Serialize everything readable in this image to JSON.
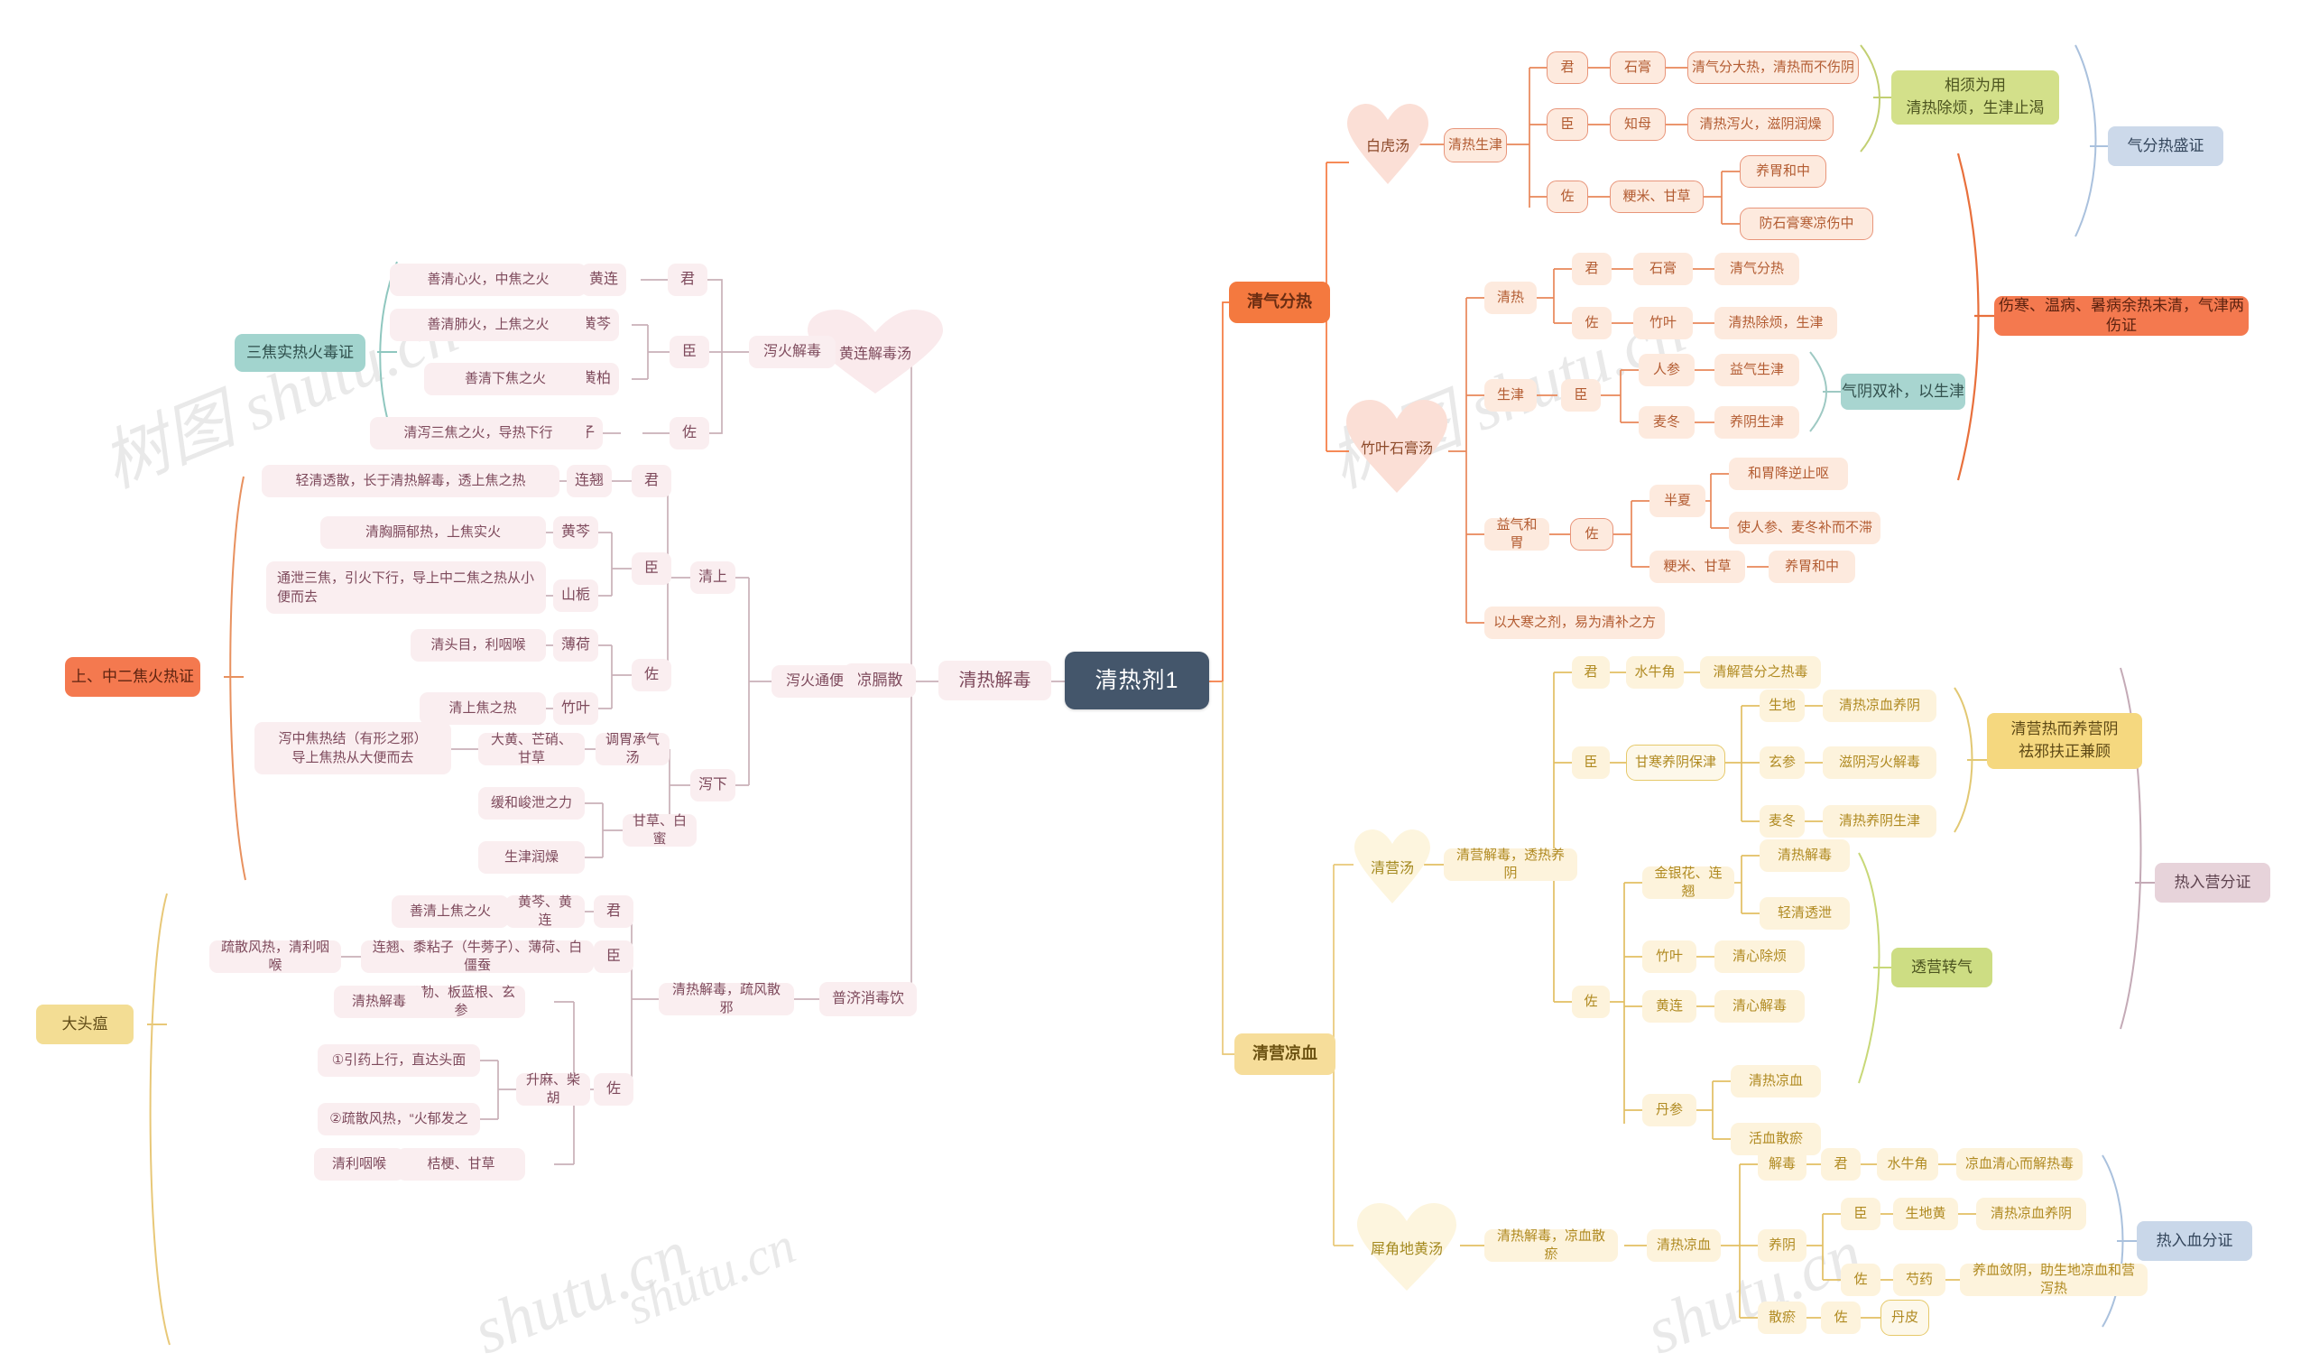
{
  "root": {
    "label": "清热剂1"
  },
  "watermark": {
    "text": "树图 shutu.cn"
  },
  "branches": {
    "left": {
      "label": "清热解毒",
      "formulas": [
        {
          "name": "黄连解毒汤",
          "function": "泻火解毒",
          "syndrome": "三焦实热火毒证",
          "roles": [
            {
              "role": "君",
              "herb": "黄连",
              "effect": "善清心火，中焦之火"
            },
            {
              "role": "臣",
              "herbs": [
                "黄芩",
                "黄柏"
              ],
              "effects": [
                "善清肺火，上焦之火",
                "善清下焦之火"
              ]
            },
            {
              "role": "佐",
              "herb": "栀子",
              "effect": "清泻三焦之火，导热下行"
            }
          ]
        },
        {
          "name": "凉膈散",
          "function": "泻火通便",
          "syndrome": "上、中二焦火热证",
          "groups": [
            {
              "label": "清上",
              "rows": [
                {
                  "role": "君",
                  "herb": "连翘",
                  "effect": "轻清透散，长于清热解毒，透上焦之热"
                },
                {
                  "role": "臣",
                  "herbs": [
                    "黄芩",
                    "山栀"
                  ],
                  "effects": [
                    "清胸膈郁热，上焦实火",
                    "通泄三焦，引火下行，导上中二焦之热从小便而去"
                  ]
                },
                {
                  "role": "佐",
                  "herbs": [
                    "薄荷",
                    "竹叶"
                  ],
                  "effects": [
                    "清头目，利咽喉",
                    "清上焦之热"
                  ]
                }
              ]
            },
            {
              "label": "泻下",
              "rows": [
                {
                  "herb": "调胃承气汤",
                  "sub": "大黄、芒硝、甘草",
                  "effect": "泻中焦热结（有形之邪）\n导上焦热从大便而去"
                },
                {
                  "herb": "甘草、白蜜",
                  "effects": [
                    "缓和峻泄之力",
                    "生津润燥"
                  ]
                }
              ]
            }
          ]
        },
        {
          "name": "普济消毒饮",
          "function": "清热解毒，疏风散邪",
          "syndrome": "大头瘟",
          "roles": [
            {
              "role": "君",
              "herb": "黄芩、黄连",
              "effect": "善清上焦之火"
            },
            {
              "role": "臣",
              "herb": "连翘、黍粘子（牛蒡子）、薄荷、白僵蚕",
              "effect": "疏散风热，清利咽喉"
            },
            {
              "role": "佐",
              "herbs": [
                "马勃、板蓝根、玄参",
                "升麻、柴胡",
                "桔梗、甘草"
              ],
              "effects": [
                "清热解毒",
                "①引药上行，直达头面",
                "②疏散风热，“火郁发之",
                "清利咽喉"
              ]
            }
          ]
        }
      ]
    },
    "right_top": {
      "label": "清气分热",
      "formulas": [
        {
          "name": "白虎汤",
          "function": "清热生津",
          "note": "相须为用\n清热除烦，生津止渴",
          "syndrome": "气分热盛证",
          "rows": [
            {
              "role": "君",
              "herb": "石膏",
              "effect": "清气分大热，清热而不伤阴"
            },
            {
              "role": "臣",
              "herb": "知母",
              "effect": "清热泻火，滋阴润燥"
            },
            {
              "role": "佐",
              "herb": "粳米、甘草",
              "effects": [
                "养胃和中",
                "防石膏寒凉伤中"
              ]
            }
          ]
        },
        {
          "name": "竹叶石膏汤",
          "note": "气阴双补，以生津",
          "syndrome": "伤寒、温病、暑病余热未清，气津两伤证",
          "groups": [
            {
              "label": "清热",
              "rows": [
                {
                  "role": "君",
                  "herb": "石膏",
                  "effect": "清气分热"
                },
                {
                  "role": "佐",
                  "herb": "竹叶",
                  "effect": "清热除烦，生津"
                }
              ]
            },
            {
              "label": "生津",
              "rows": [
                {
                  "role": "臣",
                  "herbs": [
                    "人参",
                    "麦冬"
                  ],
                  "effects": [
                    "益气生津",
                    "养阴生津"
                  ]
                }
              ]
            },
            {
              "label": "益气和胃",
              "rows": [
                {
                  "role": "佐",
                  "herb": "半夏",
                  "effects": [
                    "和胃降逆止呕",
                    "使人参、麦冬补而不滞"
                  ]
                },
                {
                  "herb": "粳米、甘草",
                  "effect": "养胃和中"
                }
              ]
            },
            {
              "label": "以大寒之剂，易为清补之方"
            }
          ]
        }
      ]
    },
    "right_bottom": {
      "label": "清营凉血",
      "formulas": [
        {
          "name": "清营汤",
          "function": "清营解毒，透热养阴",
          "note1": "清营热而养营阴\n祛邪扶正兼顾",
          "note2": "透营转气",
          "syndrome": "热入营分证",
          "rows": [
            {
              "role": "君",
              "herb": "水牛角",
              "effect": "清解营分之热毒"
            },
            {
              "role": "臣",
              "group": "甘寒养阴保津",
              "herbs": [
                "生地",
                "玄参",
                "麦冬"
              ],
              "effects": [
                "清热凉血养阴",
                "滋阴泻火解毒",
                "清热养阴生津"
              ]
            },
            {
              "role": "佐",
              "herbs": [
                "金银花、连翘",
                "竹叶",
                "黄连",
                "丹参"
              ],
              "effects": [
                "清热解毒",
                "轻清透泄",
                "清心除烦",
                "清心解毒",
                "清热凉血",
                "活血散瘀"
              ]
            }
          ]
        },
        {
          "name": "犀角地黄汤",
          "function": "清热解毒，凉血散瘀",
          "mid": "清热凉血",
          "syndrome": "热入血分证",
          "groups": [
            {
              "label": "解毒",
              "rows": [
                {
                  "role": "君",
                  "herb": "水牛角",
                  "effect": "凉血清心而解热毒"
                }
              ]
            },
            {
              "label": "养阴",
              "rows": [
                {
                  "role": "臣",
                  "herb": "生地黄",
                  "effect": "清热凉血养阴"
                },
                {
                  "role": "佐",
                  "herb": "芍药",
                  "effect": "养血敛阴，助生地凉血和营泻热"
                }
              ]
            },
            {
              "label": "散瘀",
              "rows": [
                {
                  "role": "佐",
                  "herb": "丹皮"
                }
              ]
            }
          ]
        }
      ]
    }
  },
  "colors": {
    "root_bg": "#44566b",
    "orange": "#f4793f",
    "yellow": "#f6dd9a",
    "pink": "#faeef0",
    "teal": "#a2d4ce",
    "blue": "#ccd9ea",
    "green": "#d3e08a",
    "mauve": "#e7d3da"
  }
}
